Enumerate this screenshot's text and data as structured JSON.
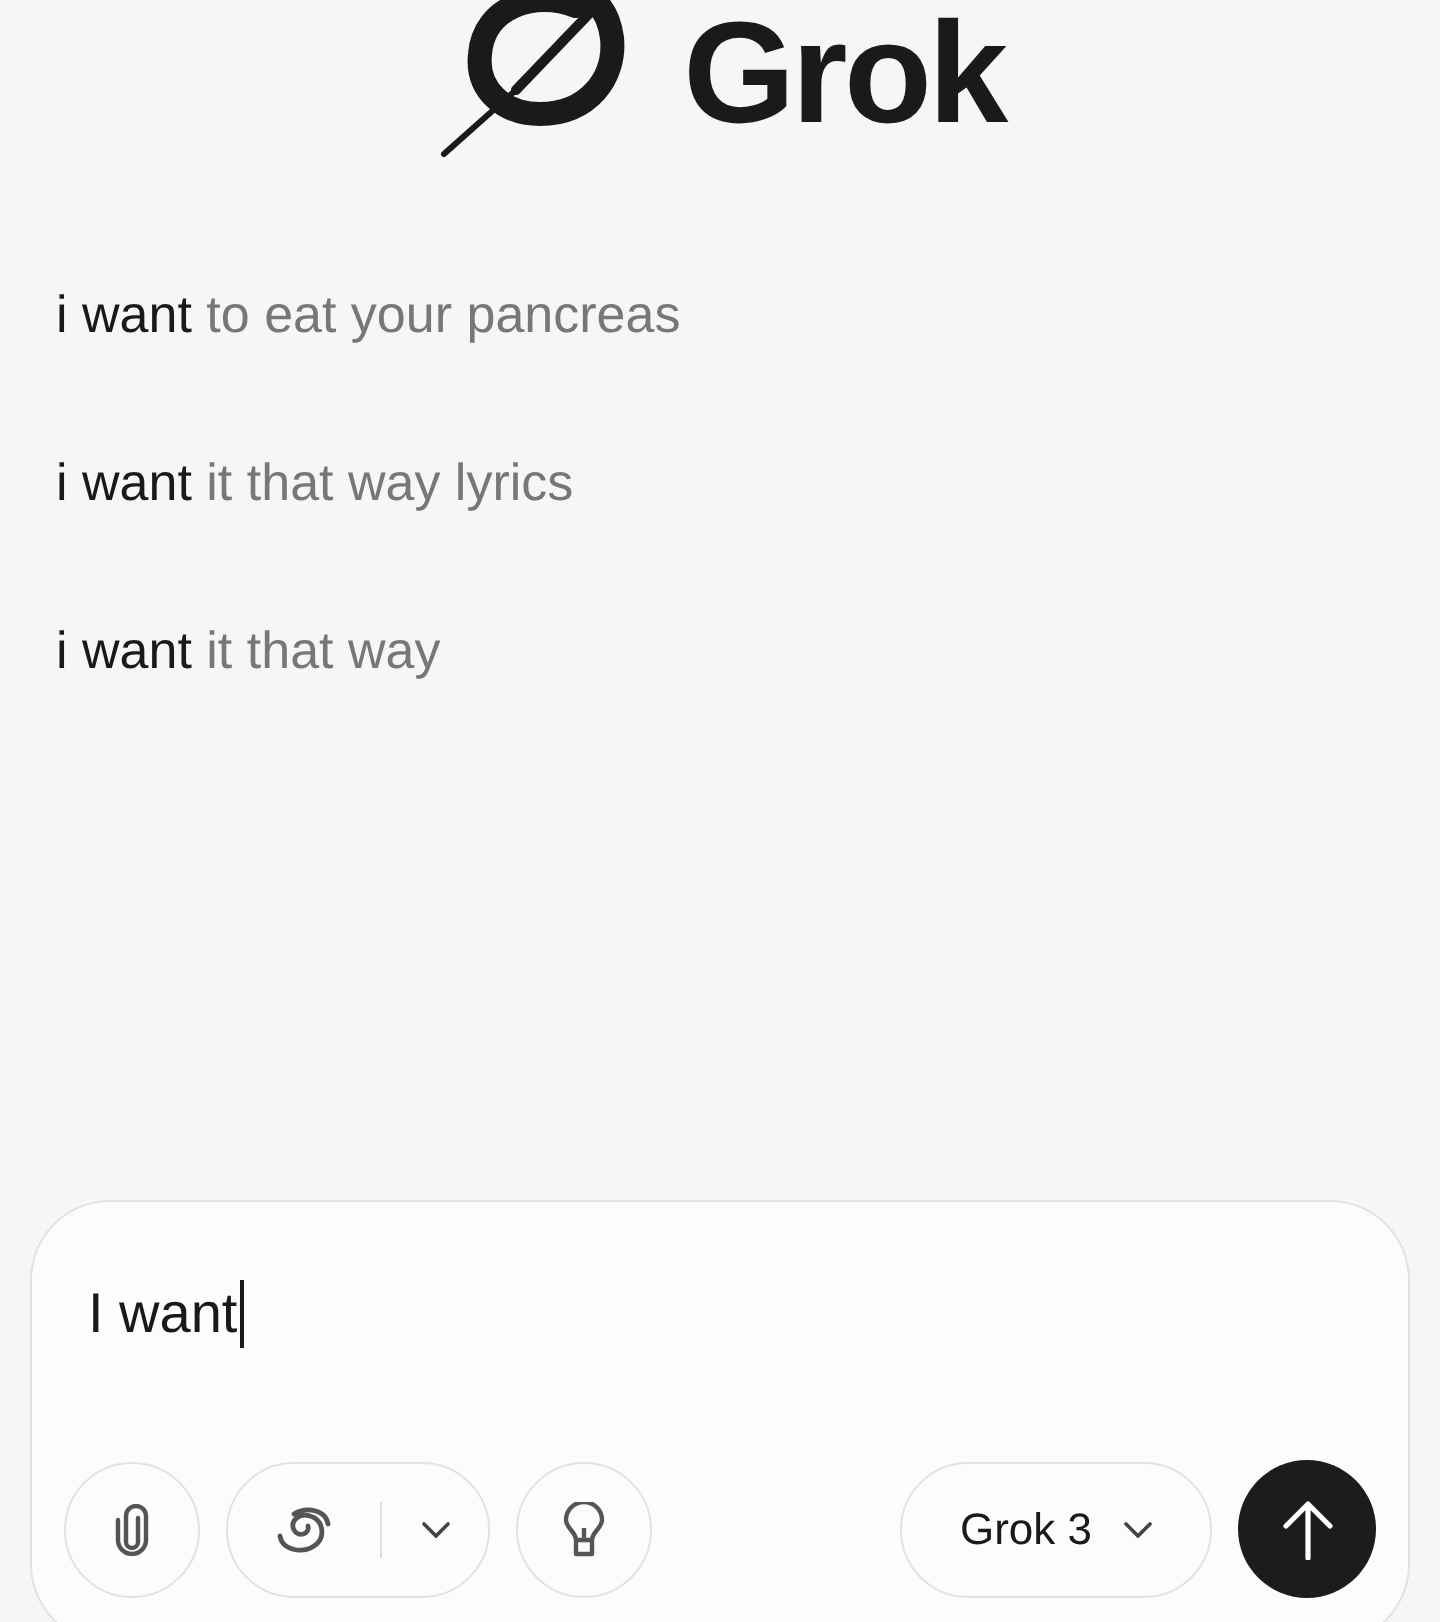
{
  "logo": {
    "wordmark": "Grok"
  },
  "suggestions": [
    {
      "typed": "i want",
      "completion": "to eat your pancreas"
    },
    {
      "typed": "i want",
      "completion": "it that way lyrics"
    },
    {
      "typed": "i want",
      "completion": "it that way"
    }
  ],
  "composer": {
    "value": "I want",
    "model": "Grok 3"
  }
}
